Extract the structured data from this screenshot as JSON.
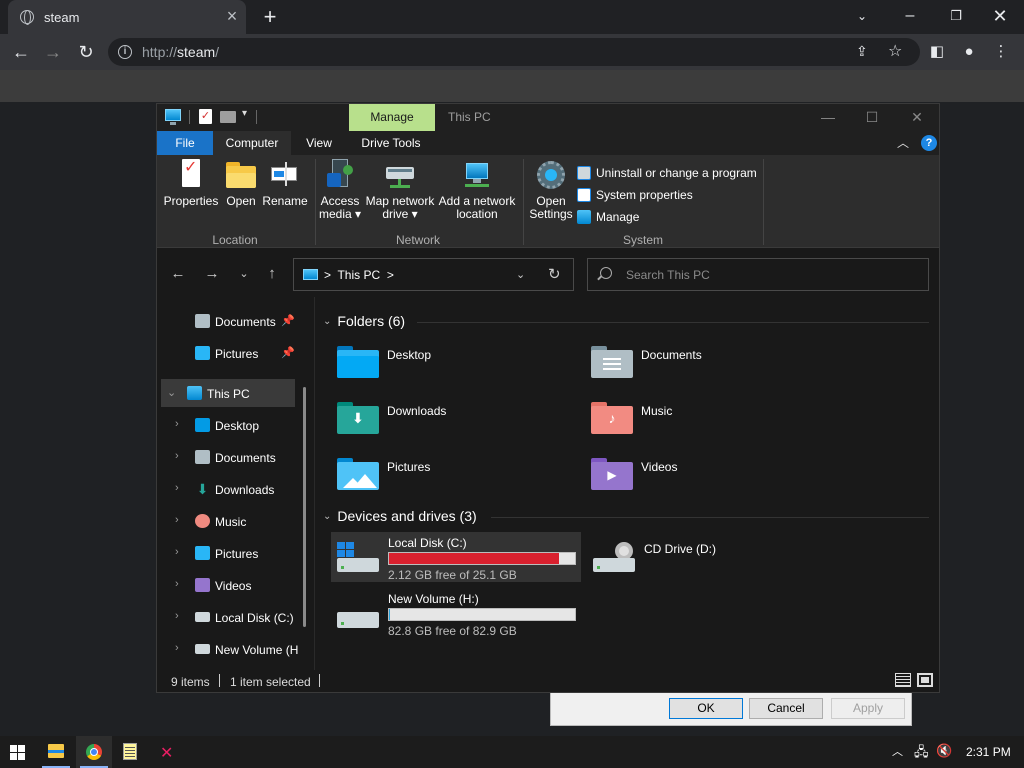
{
  "browser": {
    "tab_title": "steam",
    "url_prefix": "http://",
    "url_host": "steam",
    "url_suffix": "/"
  },
  "dialog": {
    "ok": "OK",
    "cancel": "Cancel",
    "apply": "Apply"
  },
  "explorer": {
    "contextual_tab": "Manage",
    "window_title": "This PC",
    "tabs": {
      "file": "File",
      "computer": "Computer",
      "view": "View",
      "drive_tools": "Drive Tools"
    },
    "ribbon": {
      "properties": "Properties",
      "open": "Open",
      "rename": "Rename",
      "access_media_1": "Access",
      "access_media_2": "media",
      "map_drive_1": "Map network",
      "map_drive_2": "drive",
      "add_location_1": "Add a network",
      "add_location_2": "location",
      "open_settings_1": "Open",
      "open_settings_2": "Settings",
      "uninstall": "Uninstall or change a program",
      "system_properties": "System properties",
      "manage": "Manage",
      "group_location": "Location",
      "group_network": "Network",
      "group_system": "System"
    },
    "address": {
      "path": "This PC",
      "search_placeholder": "Search This PC"
    },
    "nav": {
      "quick_documents": "Documents",
      "quick_pictures": "Pictures",
      "this_pc": "This PC",
      "desktop": "Desktop",
      "documents": "Documents",
      "downloads": "Downloads",
      "music": "Music",
      "pictures": "Pictures",
      "videos": "Videos",
      "local_disk": "Local Disk (C:)",
      "new_volume": "New Volume (H"
    },
    "sections": {
      "folders": "Folders (6)",
      "drives": "Devices and drives (3)"
    },
    "folders": {
      "desktop": "Desktop",
      "documents": "Documents",
      "downloads": "Downloads",
      "music": "Music",
      "pictures": "Pictures",
      "videos": "Videos"
    },
    "drives": {
      "c_name": "Local Disk (C:)",
      "c_free": "2.12 GB free of 25.1 GB",
      "c_used_fraction": 0.916,
      "d_name": "CD Drive (D:)",
      "h_name": "New Volume (H:)",
      "h_free": "82.8 GB free of 82.9 GB",
      "h_used_fraction": 0.001
    },
    "status": {
      "items": "9 items",
      "selected": "1 item selected"
    }
  },
  "taskbar": {
    "time": "2:31 PM"
  },
  "colors": {
    "ribbon_manage": "#b8e08c",
    "file_tab": "#1a73c8",
    "drive_critical": "#d9202e"
  }
}
